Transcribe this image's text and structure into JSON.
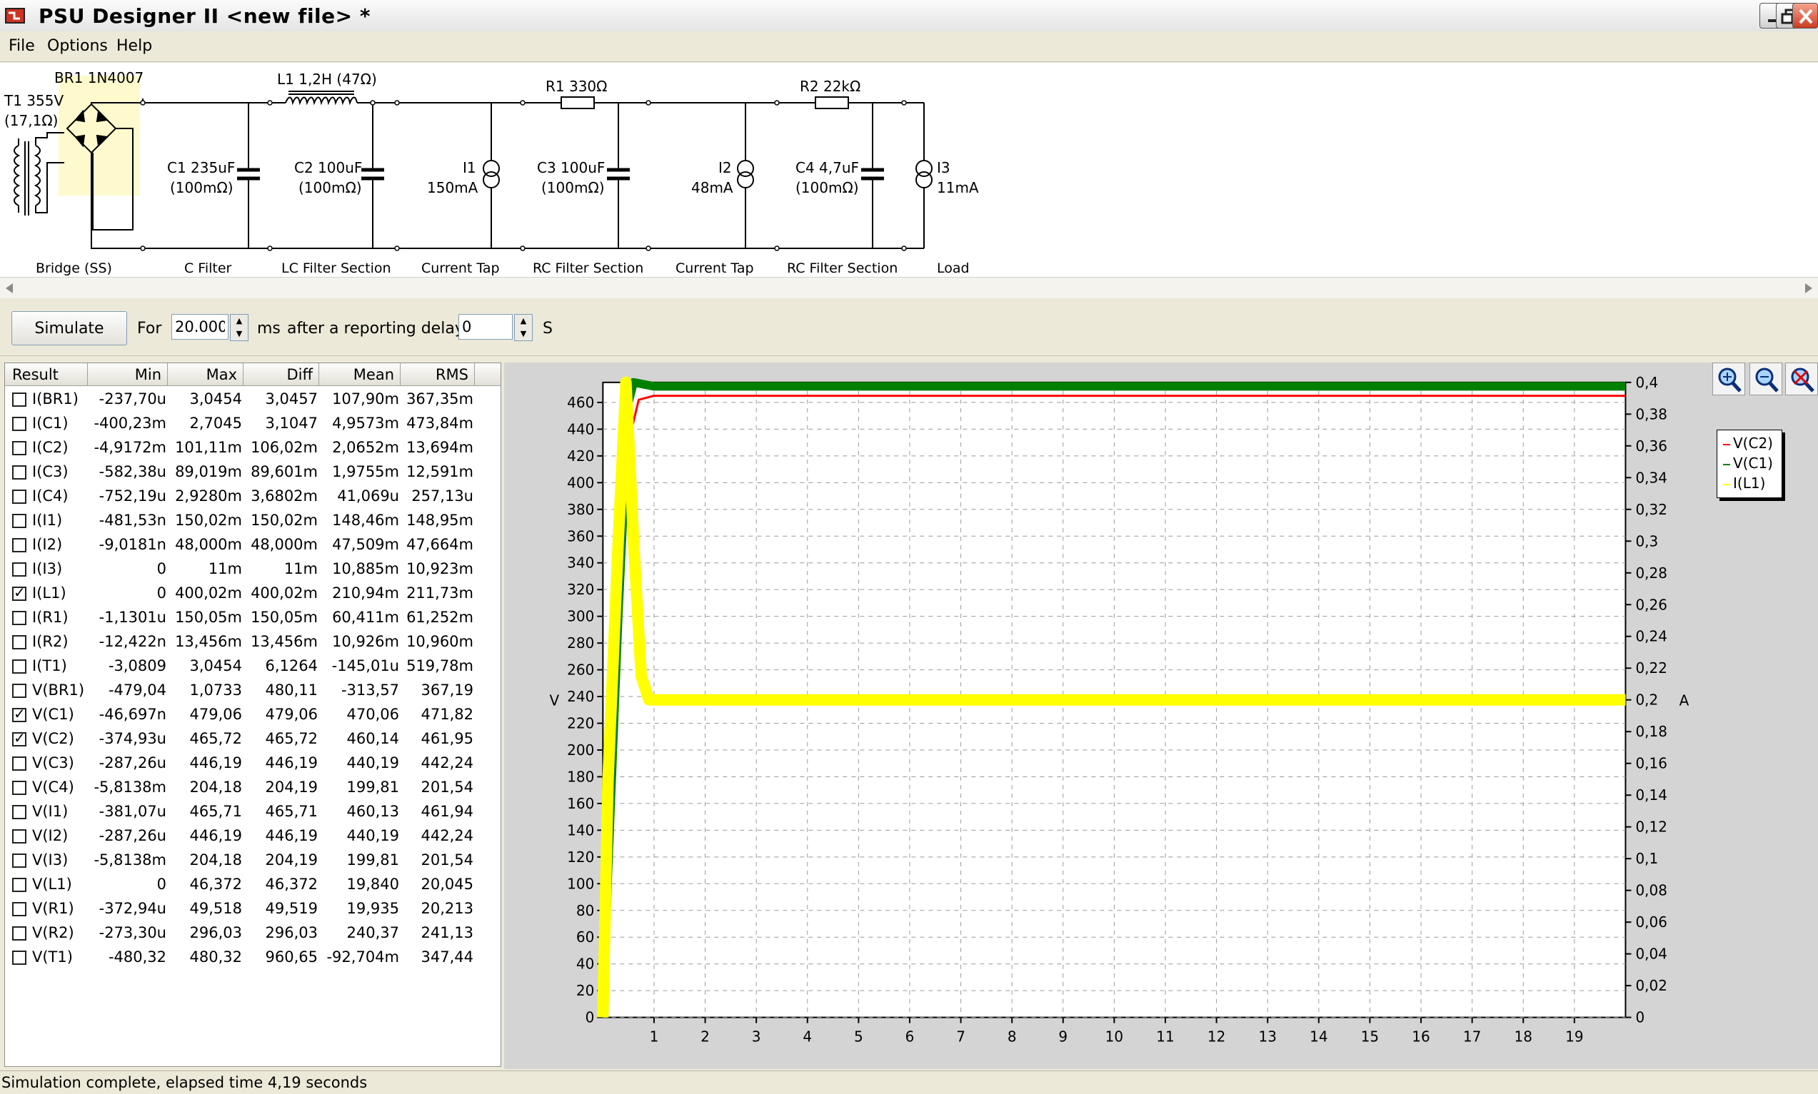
{
  "window": {
    "title": "PSU Designer II  <new file> *"
  },
  "menu": [
    "File",
    "Options",
    "Help"
  ],
  "schematic": {
    "transformer": {
      "name": "T1 355V",
      "sub": "(17,1Ω)"
    },
    "bridge": "BR1 1N4007",
    "inductor": "L1 1,2H (47Ω)",
    "r1": "R1 330Ω",
    "r2": "R2 22kΩ",
    "c1": {
      "name": "C1 235uF",
      "sub": "(100mΩ)"
    },
    "c2": {
      "name": "C2 100uF",
      "sub": "(100mΩ)"
    },
    "i1": {
      "name": "I1",
      "sub": "150mA"
    },
    "c3": {
      "name": "C3 100uF",
      "sub": "(100mΩ)"
    },
    "i2": {
      "name": "I2",
      "sub": "48mA"
    },
    "c4": {
      "name": "C4 4,7uF",
      "sub": "(100mΩ)"
    },
    "i3": {
      "name": "I3",
      "sub": "11mA"
    },
    "sections": [
      "Bridge (SS)",
      "C Filter",
      "LC Filter Section",
      "Current Tap",
      "RC Filter Section",
      "Current Tap",
      "RC Filter Section",
      "Load"
    ]
  },
  "toolbar": {
    "simulate_label": "Simulate",
    "for_label": "For",
    "duration_value": "20.000",
    "ms_label": "ms",
    "delay_label": "after a reporting delay of",
    "delay_value": "0",
    "s_label": "S"
  },
  "results": {
    "columns": [
      "Result",
      "Min",
      "Max",
      "Diff",
      "Mean",
      "RMS"
    ],
    "rows": [
      {
        "name": "I(BR1)",
        "checked": false,
        "min": "-237,70u",
        "max": "3,0454",
        "diff": "3,0457",
        "mean": "107,90m",
        "rms": "367,35m"
      },
      {
        "name": "I(C1)",
        "checked": false,
        "min": "-400,23m",
        "max": "2,7045",
        "diff": "3,1047",
        "mean": "4,9573m",
        "rms": "473,84m"
      },
      {
        "name": "I(C2)",
        "checked": false,
        "min": "-4,9172m",
        "max": "101,11m",
        "diff": "106,02m",
        "mean": "2,0652m",
        "rms": "13,694m"
      },
      {
        "name": "I(C3)",
        "checked": false,
        "min": "-582,38u",
        "max": "89,019m",
        "diff": "89,601m",
        "mean": "1,9755m",
        "rms": "12,591m"
      },
      {
        "name": "I(C4)",
        "checked": false,
        "min": "-752,19u",
        "max": "2,9280m",
        "diff": "3,6802m",
        "mean": "41,069u",
        "rms": "257,13u"
      },
      {
        "name": "I(I1)",
        "checked": false,
        "min": "-481,53n",
        "max": "150,02m",
        "diff": "150,02m",
        "mean": "148,46m",
        "rms": "148,95m"
      },
      {
        "name": "I(I2)",
        "checked": false,
        "min": "-9,0181n",
        "max": "48,000m",
        "diff": "48,000m",
        "mean": "47,509m",
        "rms": "47,664m"
      },
      {
        "name": "I(I3)",
        "checked": false,
        "min": "0",
        "max": "11m",
        "diff": "11m",
        "mean": "10,885m",
        "rms": "10,923m"
      },
      {
        "name": "I(L1)",
        "checked": true,
        "min": "0",
        "max": "400,02m",
        "diff": "400,02m",
        "mean": "210,94m",
        "rms": "211,73m"
      },
      {
        "name": "I(R1)",
        "checked": false,
        "min": "-1,1301u",
        "max": "150,05m",
        "diff": "150,05m",
        "mean": "60,411m",
        "rms": "61,252m"
      },
      {
        "name": "I(R2)",
        "checked": false,
        "min": "-12,422n",
        "max": "13,456m",
        "diff": "13,456m",
        "mean": "10,926m",
        "rms": "10,960m"
      },
      {
        "name": "I(T1)",
        "checked": false,
        "min": "-3,0809",
        "max": "3,0454",
        "diff": "6,1264",
        "mean": "-145,01u",
        "rms": "519,78m"
      },
      {
        "name": "V(BR1)",
        "checked": false,
        "min": "-479,04",
        "max": "1,0733",
        "diff": "480,11",
        "mean": "-313,57",
        "rms": "367,19"
      },
      {
        "name": "V(C1)",
        "checked": true,
        "min": "-46,697n",
        "max": "479,06",
        "diff": "479,06",
        "mean": "470,06",
        "rms": "471,82"
      },
      {
        "name": "V(C2)",
        "checked": true,
        "min": "-374,93u",
        "max": "465,72",
        "diff": "465,72",
        "mean": "460,14",
        "rms": "461,95"
      },
      {
        "name": "V(C3)",
        "checked": false,
        "min": "-287,26u",
        "max": "446,19",
        "diff": "446,19",
        "mean": "440,19",
        "rms": "442,24"
      },
      {
        "name": "V(C4)",
        "checked": false,
        "min": "-5,8138m",
        "max": "204,18",
        "diff": "204,19",
        "mean": "199,81",
        "rms": "201,54"
      },
      {
        "name": "V(I1)",
        "checked": false,
        "min": "-381,07u",
        "max": "465,71",
        "diff": "465,71",
        "mean": "460,13",
        "rms": "461,94"
      },
      {
        "name": "V(I2)",
        "checked": false,
        "min": "-287,26u",
        "max": "446,19",
        "diff": "446,19",
        "mean": "440,19",
        "rms": "442,24"
      },
      {
        "name": "V(I3)",
        "checked": false,
        "min": "-5,8138m",
        "max": "204,18",
        "diff": "204,19",
        "mean": "199,81",
        "rms": "201,54"
      },
      {
        "name": "V(L1)",
        "checked": false,
        "min": "0",
        "max": "46,372",
        "diff": "46,372",
        "mean": "19,840",
        "rms": "20,045"
      },
      {
        "name": "V(R1)",
        "checked": false,
        "min": "-372,94u",
        "max": "49,518",
        "diff": "49,519",
        "mean": "19,935",
        "rms": "20,213"
      },
      {
        "name": "V(R2)",
        "checked": false,
        "min": "-273,30u",
        "max": "296,03",
        "diff": "296,03",
        "mean": "240,37",
        "rms": "241,13"
      },
      {
        "name": "V(T1)",
        "checked": false,
        "min": "-480,32",
        "max": "480,32",
        "diff": "960,65",
        "mean": "-92,704m",
        "rms": "347,44"
      }
    ]
  },
  "chart_data": {
    "type": "line",
    "xlim": [
      0,
      20
    ],
    "x_ticks": [
      "1",
      "2",
      "3",
      "4",
      "5",
      "6",
      "7",
      "8",
      "9",
      "10",
      "11",
      "12",
      "13",
      "14",
      "15",
      "16",
      "17",
      "18",
      "19"
    ],
    "ylabel_left": "V",
    "ylim_left": [
      0,
      475
    ],
    "y_ticks_left": [
      "0",
      "20",
      "40",
      "60",
      "80",
      "100",
      "120",
      "140",
      "160",
      "180",
      "200",
      "220",
      "240",
      "260",
      "280",
      "300",
      "320",
      "340",
      "360",
      "380",
      "400",
      "420",
      "440",
      "460"
    ],
    "ylabel_right": "A",
    "ylim_right": [
      0,
      0.4
    ],
    "y_ticks_right": [
      "0",
      "0,02",
      "0,04",
      "0,06",
      "0,08",
      "0,1",
      "0,12",
      "0,14",
      "0,16",
      "0,18",
      "0,2",
      "0,22",
      "0,24",
      "0,26",
      "0,28",
      "0,3",
      "0,32",
      "0,34",
      "0,36",
      "0,38",
      "0,4"
    ],
    "grid": true,
    "legend_position": "right",
    "series": [
      {
        "name": "V(C2)",
        "color": "#ff0000",
        "axis": "left",
        "x": [
          0,
          0.1,
          0.3,
          0.5,
          0.7,
          1,
          20
        ],
        "y": [
          0,
          120,
          300,
          430,
          462,
          465,
          465
        ]
      },
      {
        "name": "V(C1)",
        "color": "#008000",
        "axis": "left",
        "x": [
          0,
          0.1,
          0.3,
          0.5,
          0.6,
          1,
          20
        ],
        "y": [
          0,
          110,
          300,
          460,
          475,
          472,
          472
        ]
      },
      {
        "name": "I(L1)",
        "color": "#ffff00",
        "axis": "right",
        "x": [
          0,
          0.1,
          0.3,
          0.45,
          0.6,
          0.75,
          0.9,
          20
        ],
        "y": [
          0,
          0.15,
          0.3,
          0.4,
          0.3,
          0.215,
          0.2,
          0.2
        ]
      }
    ]
  },
  "status": "Simulation complete, elapsed time 4,19 seconds"
}
